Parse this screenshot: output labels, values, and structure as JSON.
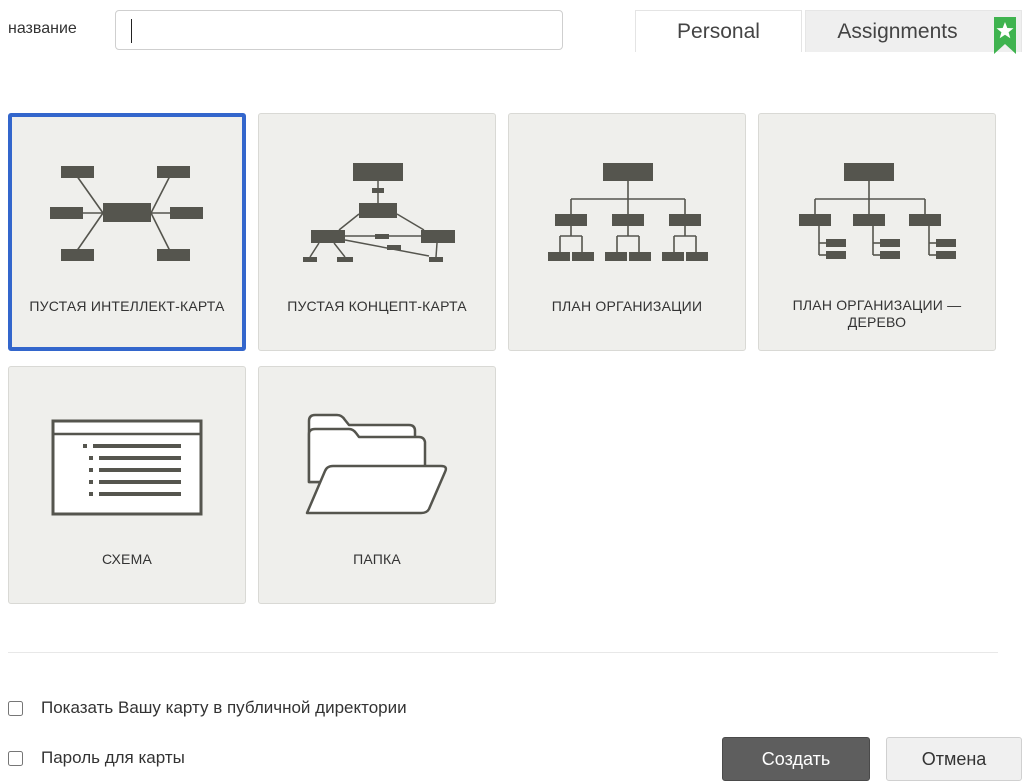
{
  "form": {
    "name_label": "название",
    "name_value": "",
    "name_placeholder": ""
  },
  "tabs": [
    {
      "label": "Personal",
      "active": true
    },
    {
      "label": "Assignments",
      "active": false,
      "icon": "bookmark-star-icon"
    }
  ],
  "templates": [
    {
      "label": "ПУСТАЯ ИНТЕЛЛЕКТ-КАРТА",
      "icon": "mind-map-icon",
      "selected": true
    },
    {
      "label": "ПУСТАЯ КОНЦЕПТ-КАРТА",
      "icon": "concept-map-icon",
      "selected": false
    },
    {
      "label": "ПЛАН ОРГАНИЗАЦИИ",
      "icon": "org-chart-icon",
      "selected": false
    },
    {
      "label": "ПЛАН ОРГАНИЗАЦИИ — ДЕРЕВО",
      "icon": "org-tree-icon",
      "selected": false
    },
    {
      "label": "СХЕМА",
      "icon": "outline-icon",
      "selected": false
    },
    {
      "label": "ПАПКА",
      "icon": "folder-icon",
      "selected": false
    }
  ],
  "options": {
    "public_label": "Показать Вашу карту в публичной директории",
    "public_checked": false,
    "password_label": "Пароль для карты",
    "password_checked": false
  },
  "buttons": {
    "create": "Создать",
    "cancel": "Отмена"
  },
  "colors": {
    "selected_border": "#3366cc",
    "icon_fill": "#55554e",
    "bookmark_green": "#3fb34f",
    "create_bg": "#5e5e5e"
  }
}
